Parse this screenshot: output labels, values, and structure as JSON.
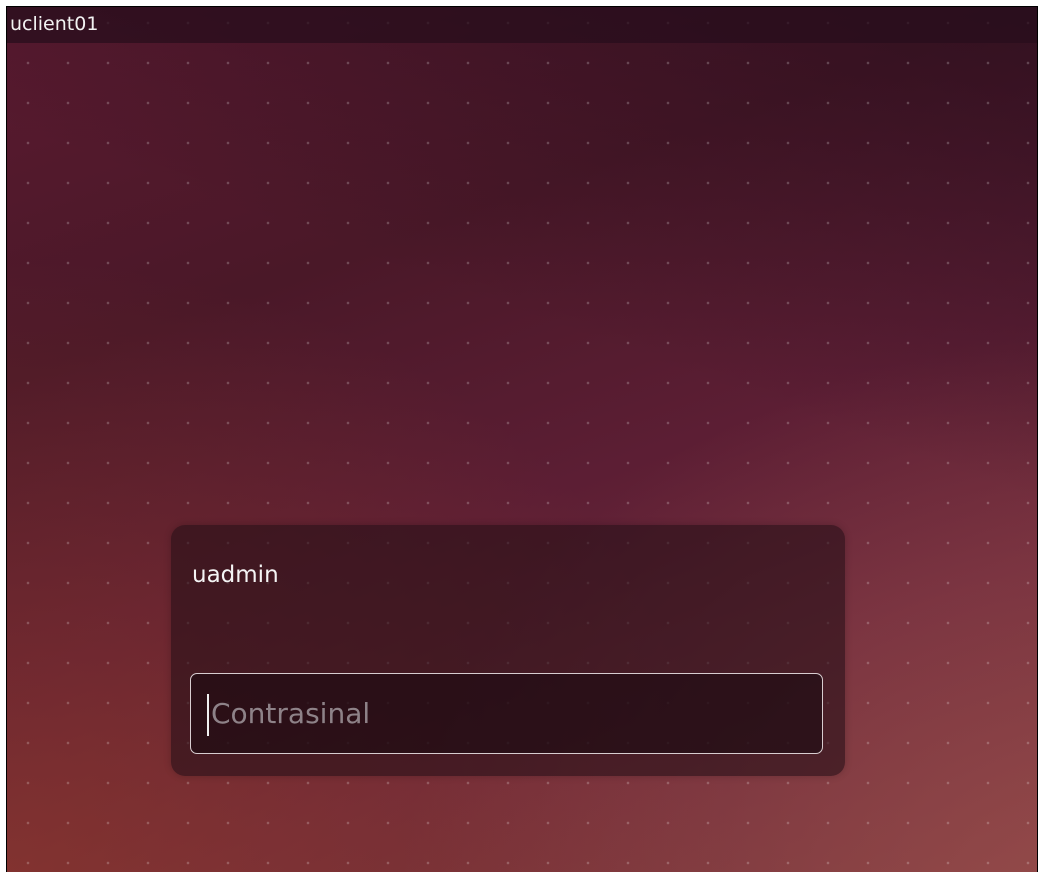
{
  "topbar": {
    "hostname": "uclient01"
  },
  "login": {
    "username": "uadmin",
    "password_placeholder": "Contrasinal"
  },
  "colors": {
    "panel_background": "#2a1018",
    "field_border": "#d8cdd0",
    "placeholder_text": "#8e8288",
    "background_top": "#4a1828",
    "background_bottom": "#7a3838"
  }
}
